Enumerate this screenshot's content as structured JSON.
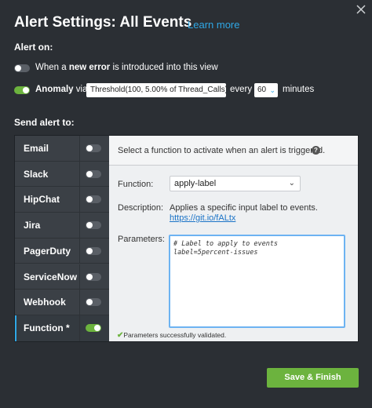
{
  "header": {
    "title": "Alert Settings: All Events",
    "learn_more": "Learn more"
  },
  "alert_on": {
    "label": "Alert on:",
    "new_error": {
      "prefix": "When a ",
      "bold": "new error",
      "suffix": " is introduced into this view",
      "enabled": false
    },
    "anomaly": {
      "bold": "Anomaly",
      "via": "via",
      "threshold_value": "Threshold(100, 5.00% of Thread_Calls)",
      "every": "every",
      "interval_value": "60",
      "unit": "minutes",
      "enabled": true
    }
  },
  "send_alert": {
    "label": "Send alert to:",
    "channels": [
      {
        "label": "Email",
        "enabled": false
      },
      {
        "label": "Slack",
        "enabled": false
      },
      {
        "label": "HipChat",
        "enabled": false
      },
      {
        "label": "Jira",
        "enabled": false
      },
      {
        "label": "PagerDuty",
        "enabled": false
      },
      {
        "label": "ServiceNow",
        "enabled": false
      },
      {
        "label": "Webhook",
        "enabled": false
      },
      {
        "label": "Function *",
        "enabled": true,
        "active": true
      }
    ]
  },
  "function_panel": {
    "instructions": "Select a function to activate when an alert is triggered.",
    "function_label": "Function:",
    "function_value": "apply-label",
    "description_label": "Description:",
    "description_text": "Applies a specific input label to events.",
    "description_link": "https://git.io/fALtx",
    "parameters_label": "Parameters:",
    "parameters_value": "# Label to apply to events\nlabel=5percent-issues",
    "validation_message": "Parameters successfully validated."
  },
  "footer": {
    "save_label": "Save & Finish"
  },
  "colors": {
    "background": "#2b2f34",
    "accent_green": "#6cb33e",
    "link_blue": "#2fa8e6"
  }
}
